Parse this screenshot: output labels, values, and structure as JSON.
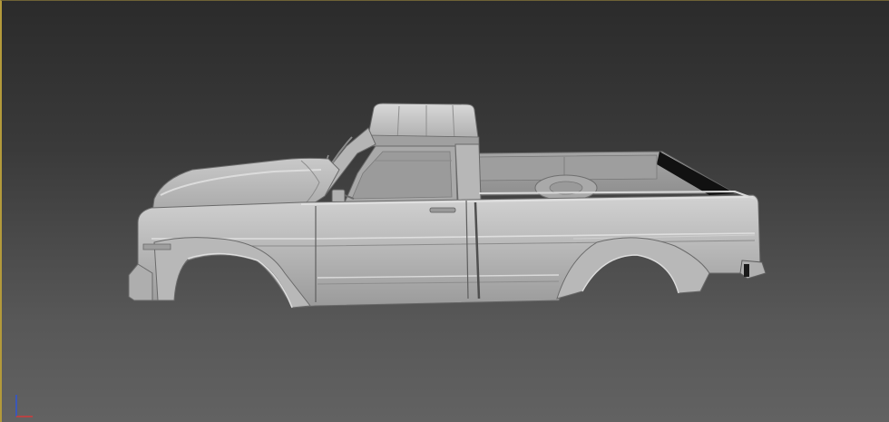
{
  "viewport": {
    "background_top": "#2b2b2b",
    "background_bottom": "#626262",
    "active_border_color": "#b39a3b"
  },
  "model": {
    "body_color": "#b3b3b3",
    "body_highlight": "#cfcfcf",
    "body_shadow": "#7d7d7d",
    "edge_color": "#5e5e5e",
    "bed_interior_color": "#101010"
  },
  "gizmo": {
    "x_axis_color": "#d23a3a",
    "y_axis_color": "#2f55d4",
    "icon": "view-axis-gizmo-icon"
  }
}
